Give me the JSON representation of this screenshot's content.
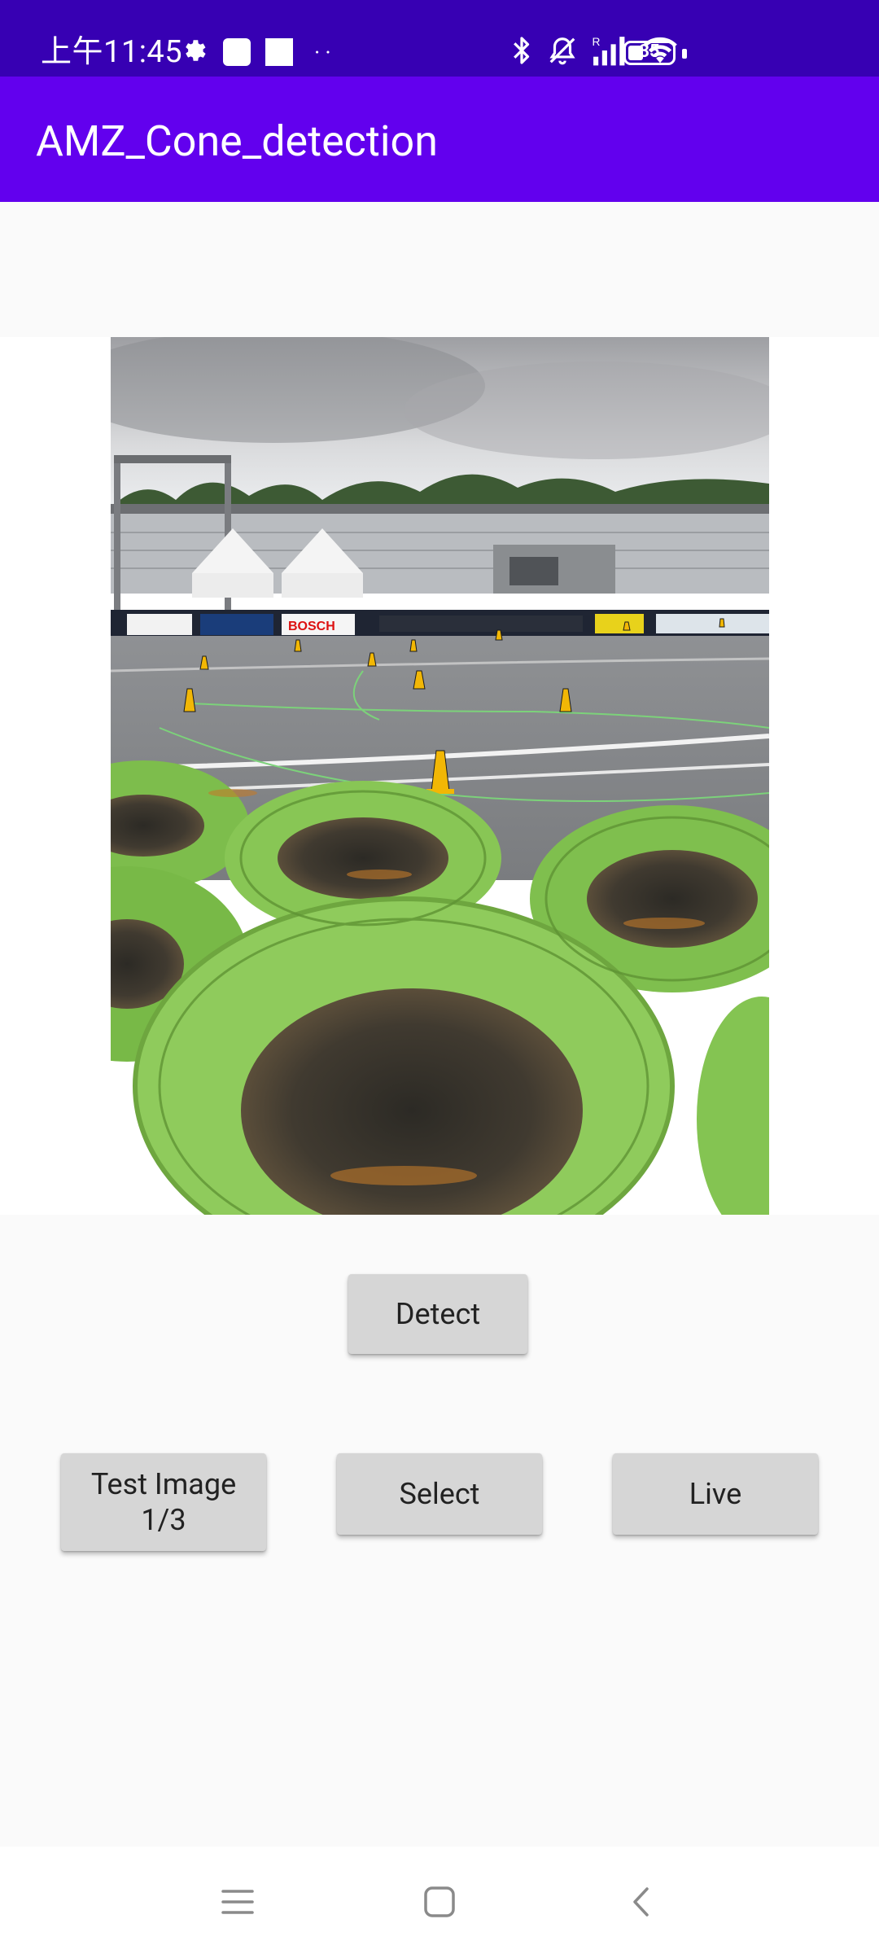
{
  "status_bar": {
    "time": "上午11:45",
    "battery_level": "35",
    "icons": [
      "gear-icon",
      "notification-square-icon",
      "notification-square-icon",
      "more-dots-icon",
      "bluetooth-icon",
      "silent-bell-icon",
      "signal-icon",
      "wifi-icon",
      "battery-icon"
    ],
    "background": "#3700b3"
  },
  "app_bar": {
    "title": "AMZ_Cone_detection",
    "background": "#6200ee"
  },
  "image_view": {
    "description_icon": "race-track-cones-tires-photo"
  },
  "buttons": {
    "detect": "Detect",
    "test_image_line1": "Test Image",
    "test_image_line2": "1/3",
    "select": "Select",
    "live": "Live"
  },
  "navigation_bar": {
    "icons": [
      "menu-icon",
      "home-icon",
      "back-icon"
    ]
  },
  "colors": {
    "button_bg": "#d6d6d6",
    "page_bg": "#fafafa"
  }
}
